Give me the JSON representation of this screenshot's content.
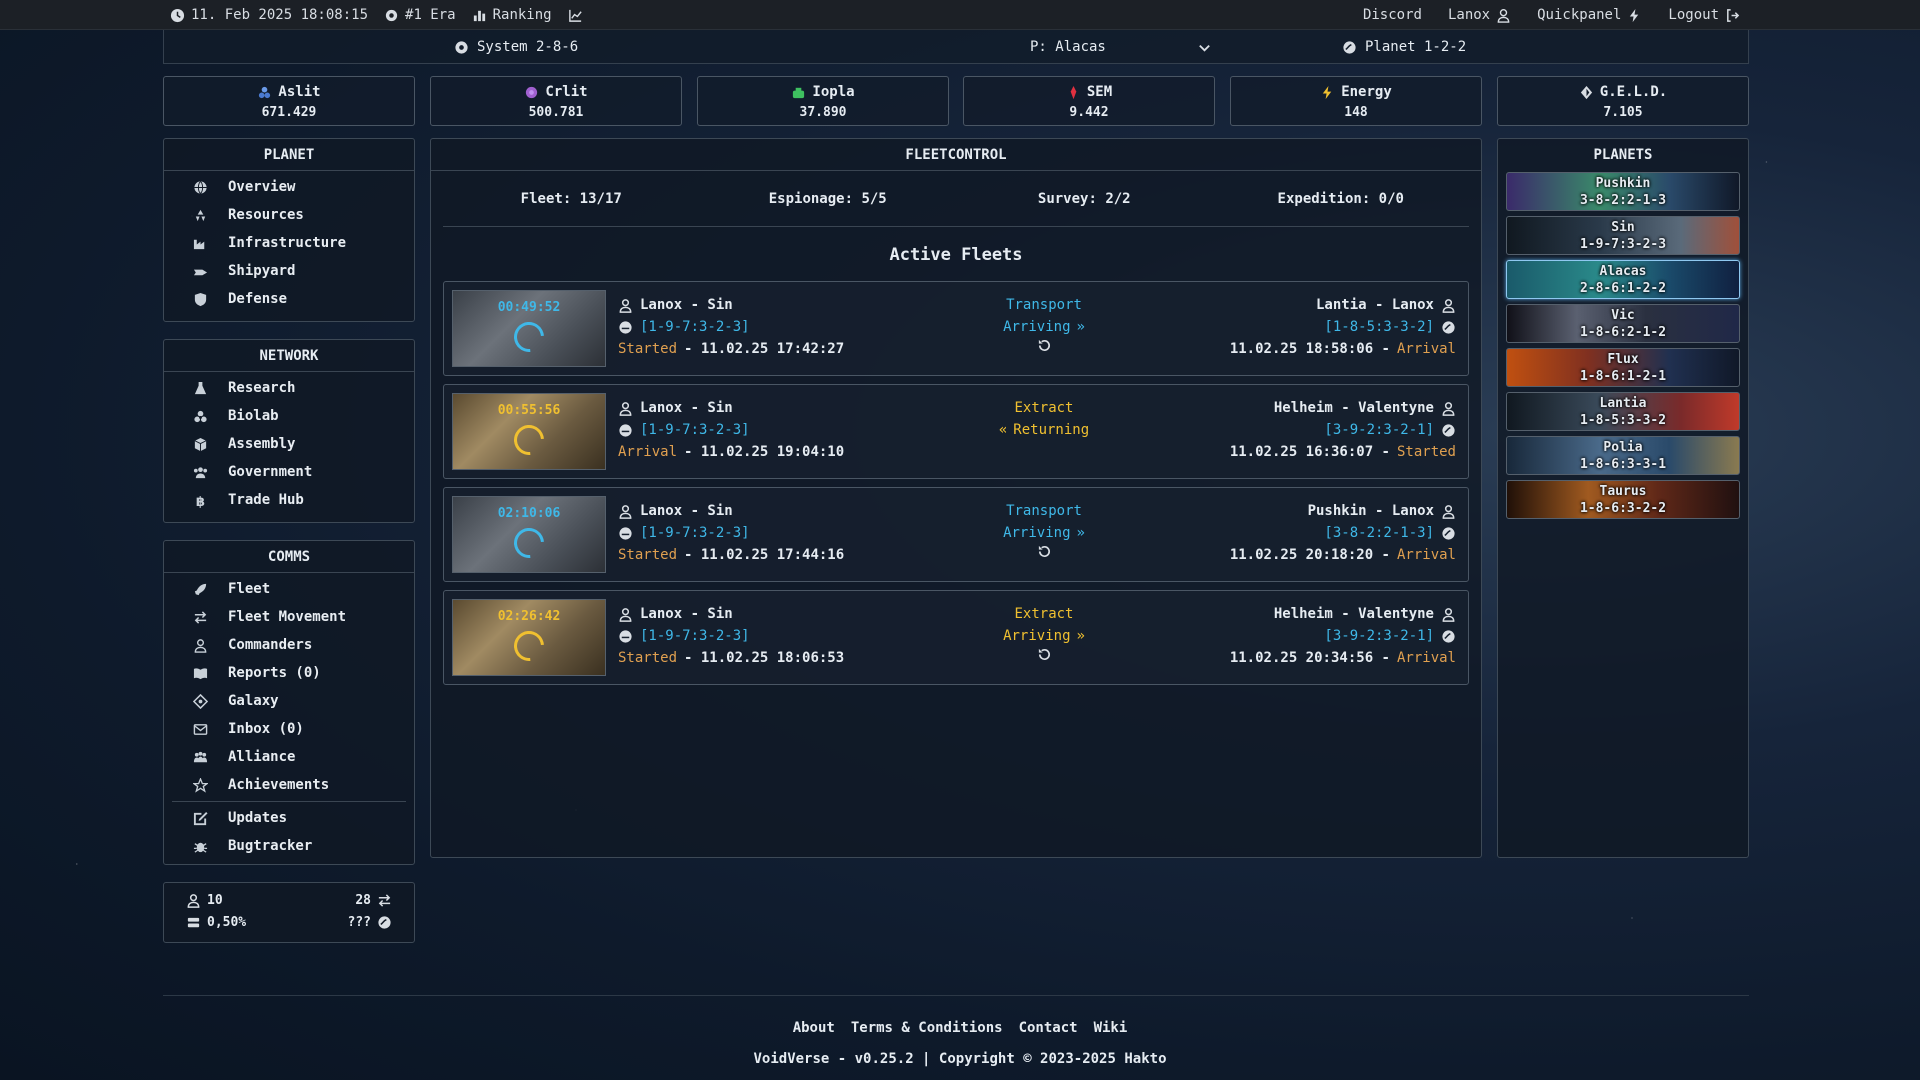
{
  "topbar": {
    "datetime": "11. Feb 2025 18:08:15",
    "era": "#1 Era",
    "ranking": "Ranking",
    "discord": "Discord",
    "user": "Lanox",
    "quickpanel": "Quickpanel",
    "logout": "Logout"
  },
  "sysbar": {
    "system": "System 2-8-6",
    "planet_select": "P: Alacas",
    "planet": "Planet 1-2-2"
  },
  "resources": [
    {
      "name": "Aslit",
      "value": "671.429",
      "icon": "aslit-icon",
      "color": "#4a7ad0"
    },
    {
      "name": "Crlit",
      "value": "500.781",
      "icon": "crlit-icon",
      "color": "#a060d0"
    },
    {
      "name": "Iopla",
      "value": "37.890",
      "icon": "iopla-icon",
      "color": "#3ec060"
    },
    {
      "name": "SEM",
      "value": "9.442",
      "icon": "sem-icon",
      "color": "#e03040"
    },
    {
      "name": "Energy",
      "value": "148",
      "icon": "bolt-icon",
      "color": "#f0c030"
    },
    {
      "name": "G.E.L.D.",
      "value": "7.105",
      "icon": "geld-icon",
      "color": "#d8dde3"
    }
  ],
  "nav": {
    "planet_title": "PLANET",
    "planet": [
      "Overview",
      "Resources",
      "Infrastructure",
      "Shipyard",
      "Defense"
    ],
    "network_title": "NETWORK",
    "network": [
      "Research",
      "Biolab",
      "Assembly",
      "Government",
      "Trade Hub"
    ],
    "comms_title": "COMMS",
    "comms": [
      "Fleet",
      "Fleet Movement",
      "Commanders",
      "Reports (0)",
      "Galaxy",
      "Inbox (0)",
      "Alliance",
      "Achievements"
    ],
    "extra": [
      "Updates",
      "Bugtracker"
    ]
  },
  "statbox": {
    "players": "10",
    "trades": "28",
    "percent": "0,50%",
    "unknown": "???"
  },
  "fleetcontrol": {
    "title": "FLEETCONTROL",
    "fleet": "Fleet: 13/17",
    "espionage": "Espionage: 5/5",
    "survey": "Survey: 2/2",
    "expedition": "Expedition: 0/0",
    "active_title": "Active Fleets",
    "fleets": [
      {
        "timer": "00:49:52",
        "from": "Lanox - Sin",
        "from_coord": "[1-9-7:3-2-3]",
        "from_label": "Started",
        "from_time": "- 11.02.25 17:42:27",
        "mission": "Transport",
        "status": "Arriving",
        "to": "Lantia - Lanox",
        "to_coord": "[1-8-5:3-3-2]",
        "to_time": "11.02.25 18:58:06 -",
        "to_label": "Arrival"
      },
      {
        "timer": "00:55:56",
        "from": "Lanox - Sin",
        "from_coord": "[1-9-7:3-2-3]",
        "from_label": "Arrival",
        "from_time": "- 11.02.25 19:04:10",
        "mission": "Extract",
        "status": "Returning",
        "to": "Helheim - Valentyne",
        "to_coord": "[3-9-2:3-2-1]",
        "to_time": "11.02.25 16:36:07 -",
        "to_label": "Started"
      },
      {
        "timer": "02:10:06",
        "from": "Lanox - Sin",
        "from_coord": "[1-9-7:3-2-3]",
        "from_label": "Started",
        "from_time": "- 11.02.25 17:44:16",
        "mission": "Transport",
        "status": "Arriving",
        "to": "Pushkin - Lanox",
        "to_coord": "[3-8-2:2-1-3]",
        "to_time": "11.02.25 20:18:20 -",
        "to_label": "Arrival"
      },
      {
        "timer": "02:26:42",
        "from": "Lanox - Sin",
        "from_coord": "[1-9-7:3-2-3]",
        "from_label": "Started",
        "from_time": "- 11.02.25 18:06:53",
        "mission": "Extract",
        "status": "Arriving",
        "to": "Helheim - Valentyne",
        "to_coord": "[3-9-2:3-2-1]",
        "to_time": "11.02.25 20:34:56 -",
        "to_label": "Arrival"
      }
    ]
  },
  "planets": {
    "title": "PLANETS",
    "items": [
      {
        "name": "Pushkin",
        "coord": "3-8-2:2-1-3"
      },
      {
        "name": "Sin",
        "coord": "1-9-7:3-2-3"
      },
      {
        "name": "Alacas",
        "coord": "2-8-6:1-2-2"
      },
      {
        "name": "Vic",
        "coord": "1-8-6:2-1-2"
      },
      {
        "name": "Flux",
        "coord": "1-8-6:1-2-1"
      },
      {
        "name": "Lantia",
        "coord": "1-8-5:3-3-2"
      },
      {
        "name": "Polia",
        "coord": "1-8-6:3-3-1"
      },
      {
        "name": "Taurus",
        "coord": "1-8-6:3-2-2"
      }
    ]
  },
  "footer": {
    "about": "About",
    "terms": "Terms & Conditions",
    "contact": "Contact",
    "wiki": "Wiki",
    "copyright": "VoidVerse - v0.25.2 | Copyright © 2023-2025 Hakto"
  },
  "colors": {
    "accent_blue": "#3fb8e8",
    "accent_gold": "#f0c030",
    "label_orange": "#e0a050"
  }
}
